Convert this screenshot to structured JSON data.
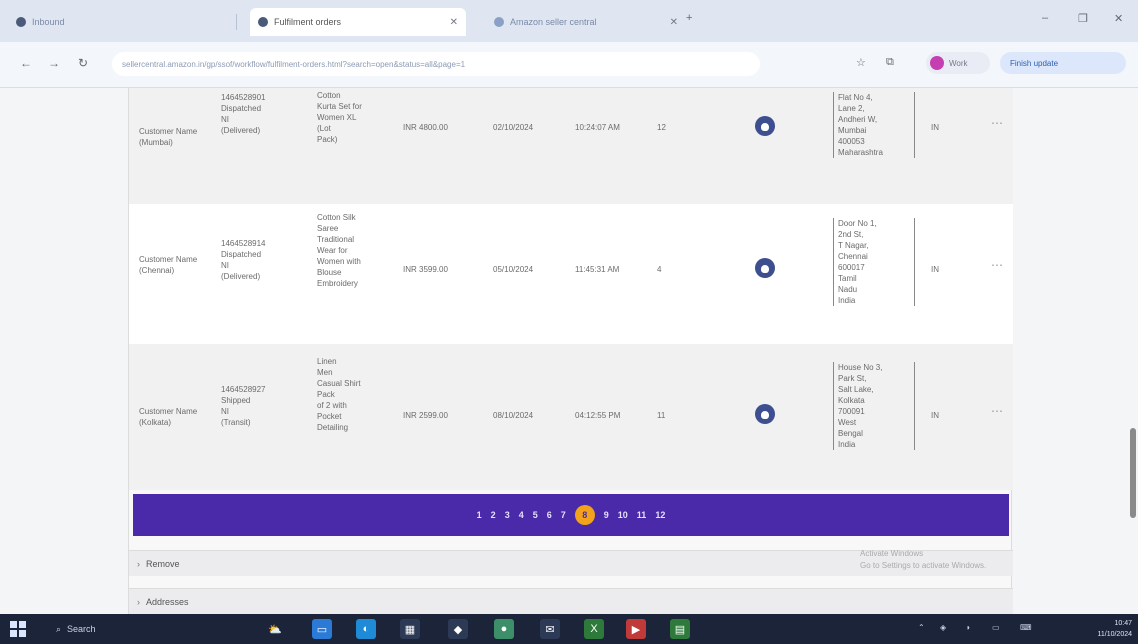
{
  "browser": {
    "tabs": [
      {
        "title": "Inbound",
        "active": false
      },
      {
        "title": "Fulfilment orders",
        "active": true
      },
      {
        "title": "Amazon seller central",
        "active": false
      }
    ],
    "url": "sellercentral.amazon.in/gp/ssof/workflow/fulfilment-orders.html?search=open&status=all&page=1",
    "profile_label": "Work",
    "update_label": "Finish update"
  },
  "orders": [
    {
      "buyer": [
        "Customer Name",
        "(Mumbai)"
      ],
      "id": [
        "1464528901",
        "Dispatched",
        "NI",
        "(Delivered)"
      ],
      "item": [
        "Cotton",
        "Kurta Set for",
        "Women XL",
        "(Lot",
        "Pack)"
      ],
      "amount": "INR 4800.00",
      "date": "02/10/2024",
      "time": "10:24:07 AM",
      "qty": "12",
      "address": [
        "Flat No 4,",
        "Lane 2,",
        "Andheri W,",
        "Mumbai",
        "400053",
        "Maharashtra"
      ],
      "status": "IN"
    },
    {
      "buyer": [
        "Customer Name",
        "(Chennai)"
      ],
      "id": [
        "1464528914",
        "Dispatched",
        "NI",
        "(Delivered)"
      ],
      "item": [
        "Cotton Silk",
        "Saree",
        "Traditional",
        "Wear for",
        "Women with",
        "Blouse",
        "Embroidery"
      ],
      "amount": "INR 3599.00",
      "date": "05/10/2024",
      "time": "11:45:31 AM",
      "qty": "4",
      "address": [
        "Door No 1,",
        "2nd St,",
        "T Nagar,",
        "Chennai",
        "600017",
        "Tamil",
        "Nadu",
        "India"
      ],
      "status": "IN"
    },
    {
      "buyer": [
        "Customer Name",
        "(Kolkata)"
      ],
      "id": [
        "1464528927",
        "Shipped",
        "NI",
        "(Transit)"
      ],
      "item": [
        "Linen",
        "Men",
        "Casual Shirt",
        "Pack",
        "of 2 with",
        "Pocket",
        "Detailing"
      ],
      "amount": "INR 2599.00",
      "date": "08/10/2024",
      "time": "04:12:55 PM",
      "qty": "11",
      "address": [
        "House No 3,",
        "Park St,",
        "Salt Lake,",
        "Kolkata",
        "700091",
        "West",
        "Bengal",
        "India"
      ],
      "status": "IN"
    }
  ],
  "pager": {
    "pages": [
      "1",
      "2",
      "3",
      "4",
      "5",
      "6",
      "7",
      "8",
      "9",
      "10",
      "11",
      "12"
    ],
    "current": "8"
  },
  "sections": [
    {
      "label": "Remove"
    },
    {
      "label": "Addresses"
    }
  ],
  "toast": [
    "Activate Windows",
    "Go to Settings to activate Windows."
  ],
  "taskbar": {
    "search_label": "Search",
    "clock": [
      "10:47",
      "11/10/2024"
    ]
  }
}
